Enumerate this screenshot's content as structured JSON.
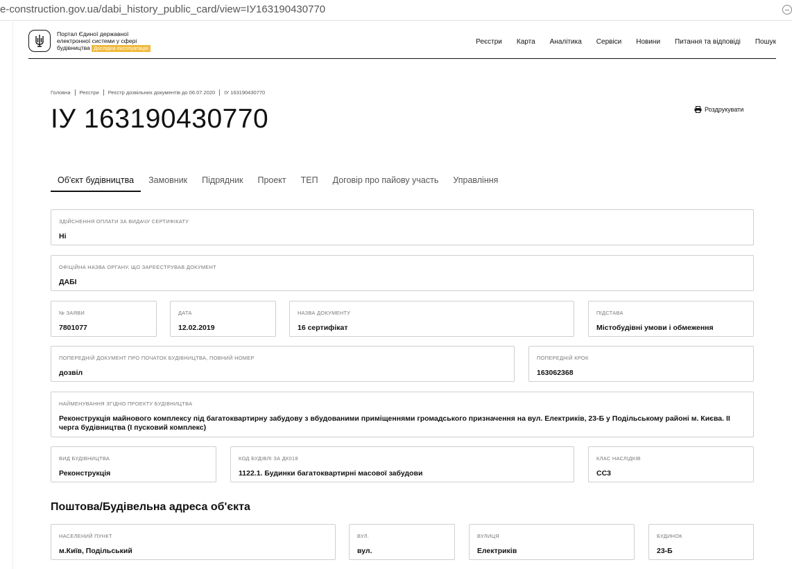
{
  "browser": {
    "url": "e-construction.gov.ua/dabi_history_public_card/view=ІУ163190430770"
  },
  "header": {
    "logo_line1": "Портал Єдиної державної",
    "logo_line2": "електронної системи у сфері",
    "logo_line3": "будівництва",
    "logo_tag": "Дослідна експлуатація",
    "nav": [
      "Реєстри",
      "Карта",
      "Аналітика",
      "Сервіси",
      "Новини",
      "Питання та відповіді",
      "Пошук"
    ]
  },
  "breadcrumb": [
    "Головна",
    "Реєстри",
    "Реєстр дозвільних документів до 06.07.2020",
    "ІУ 163190430770"
  ],
  "page": {
    "title": "ІУ 163190430770",
    "print_label": "Роздрукувати"
  },
  "tabs": [
    "Об'єкт будівництва",
    "Замовник",
    "Підрядник",
    "Проект",
    "ТЕП",
    "Договір про пайову участь",
    "Управління"
  ],
  "fields": {
    "payment": {
      "label": "Здійснення оплати за видачу сертифікату",
      "value": "Ні"
    },
    "authority": {
      "label": "Офіційна назва органу, що зареєстрував документ",
      "value": "ДАБІ"
    },
    "application_no": {
      "label": "№ заяви",
      "value": "7801077"
    },
    "date": {
      "label": "Дата",
      "value": "12.02.2019"
    },
    "doc_name": {
      "label": "Назва документу",
      "value": "16 сертифікат"
    },
    "basis": {
      "label": "Підстава",
      "value": "Містобудівні умови і обмеження"
    },
    "prev_doc": {
      "label": "Попередній документ про початок будівництва, повний номер",
      "value": "дозвіл"
    },
    "prev_step": {
      "label": "Попередній крок",
      "value": "163062368"
    },
    "project_name": {
      "label": "Найменування згідно проекту будівництва",
      "value": "Реконструкція майнового комплексу під багатоквартирну забудову з вбудованими приміщеннями громадського призначення на вул. Електриків, 23-Б у Подільському районі м. Києва. ІІ черга будівництва (І пусковий комплекс)"
    },
    "build_type": {
      "label": "Вид будівництва",
      "value": "Реконструкція"
    },
    "building_code": {
      "label": "Код будівлі за ДК018",
      "value": "1122.1. Будинки багатоквартирні масової забудови"
    },
    "consequence_class": {
      "label": "Клас наслідків",
      "value": "СС3"
    }
  },
  "address": {
    "title": "Поштова/Будівельна адреса об'єкта",
    "settlement": {
      "label": "Населений пункт",
      "value": "м.Київ, Подільський"
    },
    "street_type": {
      "label": "Вул.",
      "value": "вул."
    },
    "street": {
      "label": "Вулиця",
      "value": "Електриків"
    },
    "building": {
      "label": "Будинок",
      "value": "23-Б"
    }
  }
}
